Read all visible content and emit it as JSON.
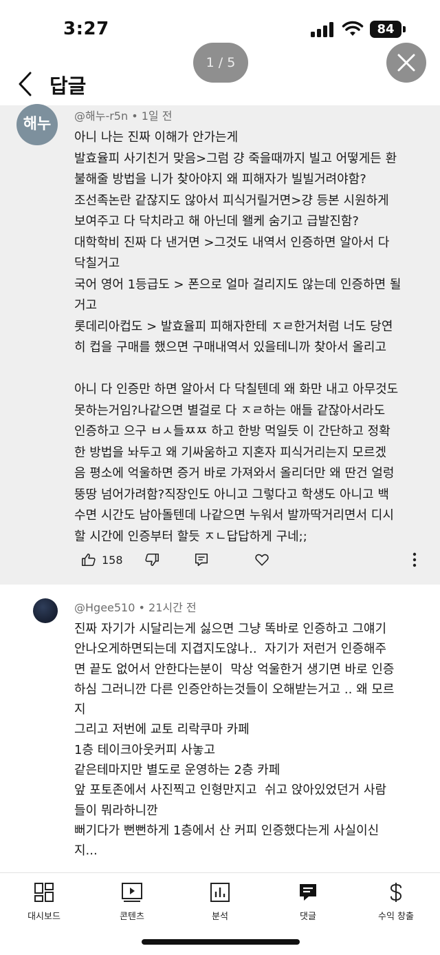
{
  "status_bar": {
    "time": "3:27",
    "battery": "84"
  },
  "header": {
    "title": "답글",
    "page_indicator": "1 / 5"
  },
  "comments": [
    {
      "avatar_text": "해누",
      "author": "@해누-r5n",
      "time": "1일 전",
      "lines": [
        "아니 나는 진짜 이해가 안가는게",
        "발효율피 사기친거 맞음>그럼 걍 죽을때까지 빌고 어떻게든 환",
        "불해줄 방법을 니가 찾아야지 왜 피해자가 빌빌거려야함?",
        "조선족논란 같잖지도 않아서 피식거릴거면>걍 등본 시원하게",
        "보여주고 다 닥치라고 해 아닌데 왤케 숨기고 급발진함?",
        "대학학비 진짜 다 낸거면 >그것도 내역서 인증하면 알아서 다",
        "닥칠거고",
        "국어 영어 1등급도 > 폰으로 얼마 걸리지도 않는데 인증하면 될",
        "거고",
        "롯데리아컵도 > 발효율피 피해자한테 ㅈㄹ한거처럼 너도 당연",
        "히 컵을 구매를 했으면 구매내역서 있을테니까 찾아서 올리고",
        "",
        "아니 다 인증만 하면 알아서 다 닥칠텐데 왜 화만 내고 아무것도",
        "못하는거임?나같으면 별걸로 다 ㅈㄹ하는 애들 같잖아서라도",
        "인증하고 으구 ㅂㅅ들ㅉㅉ 하고 한방 먹일듯 이 간단하고 정확",
        "한 방법을 놔두고 왜 기싸움하고 지혼자 피식거리는지 모르겠",
        "음 평소에 억울하면 증거 바로 가져와서 올리더만 왜 딴건 얼렁",
        "뚱땅 넘어가려함?직장인도 아니고 그렇다고 학생도 아니고 백",
        "수면 시간도 남아돌텐데 나같으면 누워서 발까딱거리면서 디시",
        "할 시간에 인증부터 할듯 ㅈㄴ답답하게 구네;;"
      ],
      "likes": "158"
    },
    {
      "author": "@Hgee510",
      "time": "21시간 전",
      "lines": [
        "진짜 자기가 시달리는게 싫으면 그냥 똑바로 인증하고 그얘기",
        "안나오게하면되는데 지겹지도않나..  자기가 저런거 인증해주",
        "면 끝도 없어서 안한다는분이  막상 억울한거 생기면 바로 인증",
        "하심 그러니깐 다른 인증안하는것들이 오해받는거고 .. 왜 모르",
        "지",
        "그리고 저번에 교토 리락쿠마 카페",
        "1층 테이크아웃커피 사놓고",
        "같은테마지만 별도로 운영하는 2층 카페",
        "앞 포토존에서 사진찍고 인형만지고  쉬고 앉아있었던거 사람",
        "들이 뭐라하니깐",
        "뻐기다가 뻔뻔하게 1층에서 산 커피 인증했다는게 사실이신",
        "지..."
      ]
    }
  ],
  "bottom_nav": [
    {
      "label": "대시보드",
      "icon": "dashboard-icon"
    },
    {
      "label": "콘텐츠",
      "icon": "content-icon"
    },
    {
      "label": "분석",
      "icon": "analytics-icon"
    },
    {
      "label": "댓글",
      "icon": "comments-icon",
      "active": true
    },
    {
      "label": "수익 창출",
      "icon": "earn-icon"
    }
  ]
}
